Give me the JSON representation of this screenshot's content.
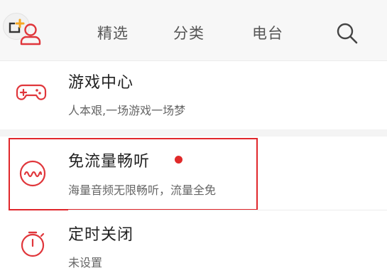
{
  "colors": {
    "accent": "#e0363b",
    "highlight": "#e0262b",
    "badge": "#f5a623"
  },
  "topbar": {
    "tabs": [
      {
        "label": "精选"
      },
      {
        "label": "分类"
      },
      {
        "label": "电台"
      }
    ]
  },
  "menu": [
    {
      "icon": "gamepad-icon",
      "title": "游戏中心",
      "subtitle": "人本艰,一场游戏一场梦"
    },
    {
      "icon": "waveform-icon",
      "title": "免流量畅听",
      "subtitle": "海量音频无限畅听，流量全免",
      "has_new_dot": true
    },
    {
      "icon": "timer-icon",
      "title": "定时关闭",
      "subtitle": "未设置"
    }
  ]
}
